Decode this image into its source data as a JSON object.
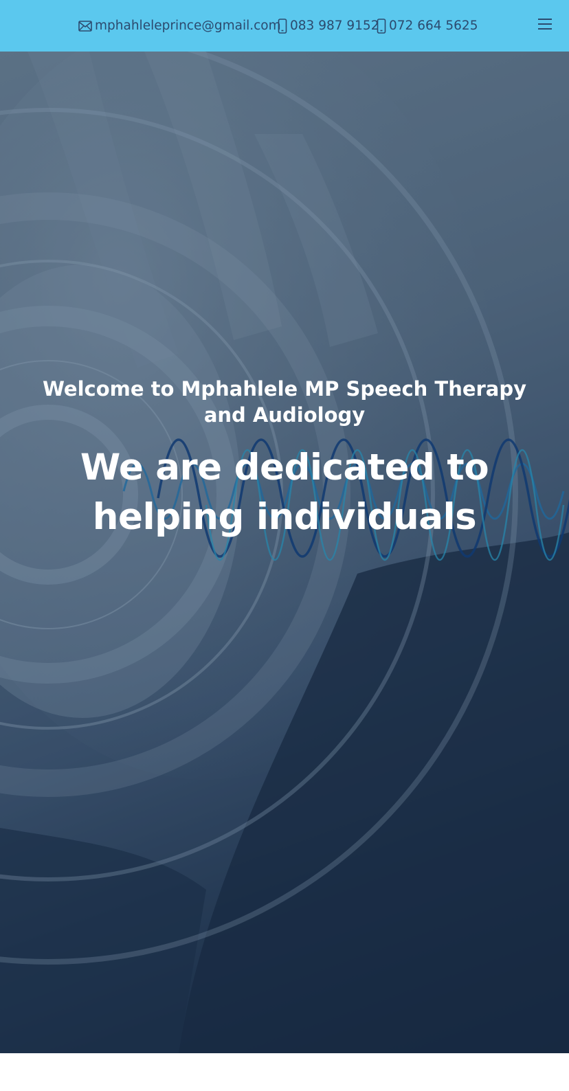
{
  "topbar": {
    "email": "mphahleleprince@gmail.com",
    "phone1": "083 987 9152",
    "phone2": "072 664 5625",
    "background": "#5bc8ee",
    "text_color": "#2c4a6e",
    "icons": {
      "email": "envelope-icon",
      "phone": "mobile-phone-icon",
      "menu": "hamburger-menu-icon"
    }
  },
  "hero": {
    "subtitle": "Welcome to Mphahlele MP Speech Therapy and Audiology",
    "title": "We are dedicated to helping individuals",
    "image": "hand-cupped-to-ear-with-sound-waves"
  }
}
